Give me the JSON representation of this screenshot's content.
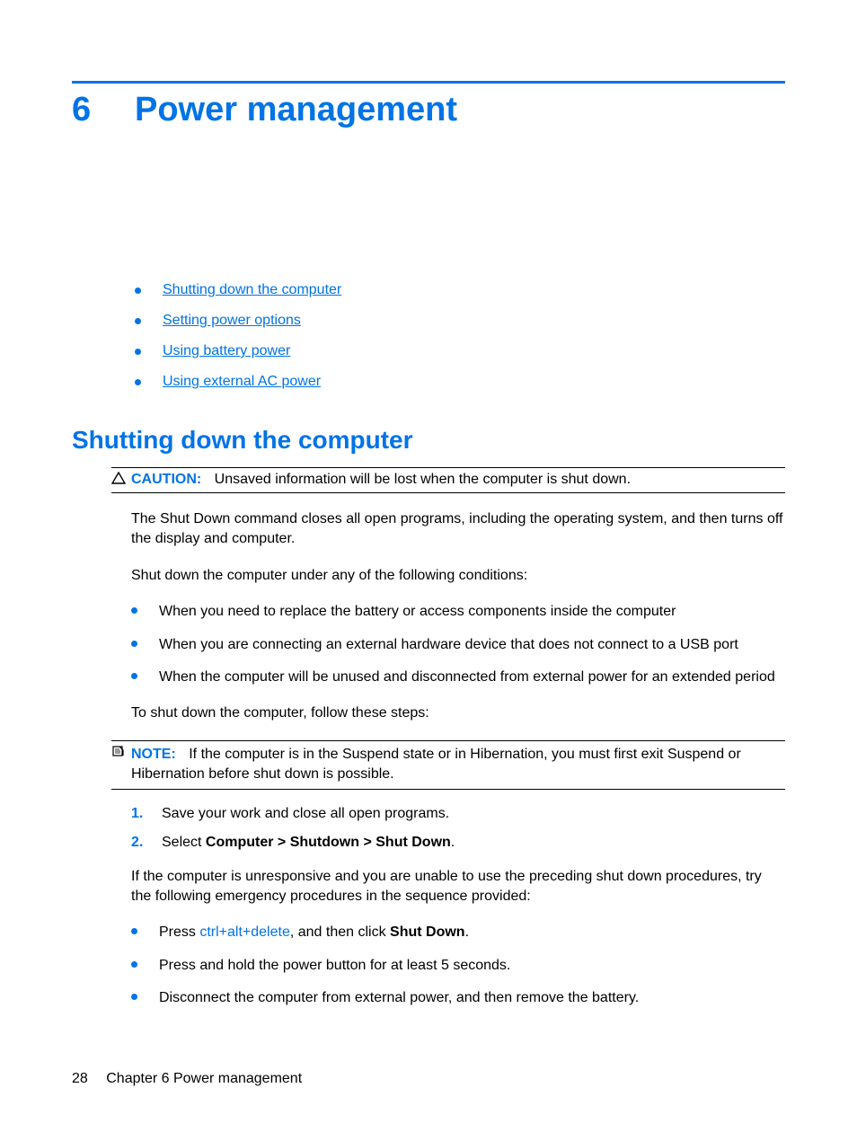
{
  "chapter": {
    "number": "6",
    "title": "Power management"
  },
  "toc": [
    "Shutting down the computer",
    "Setting power options",
    "Using battery power",
    "Using external AC power"
  ],
  "section": {
    "title": "Shutting down the computer",
    "caution": {
      "label": "CAUTION:",
      "text": "Unsaved information will be lost when the computer is shut down."
    },
    "p1": "The Shut Down command closes all open programs, including the operating system, and then turns off the display and computer.",
    "p2": "Shut down the computer under any of the following conditions:",
    "conditions": [
      "When you need to replace the battery or access components inside the computer",
      "When you are connecting an external hardware device that does not connect to a USB port",
      "When the computer will be unused and disconnected from external power for an extended period"
    ],
    "p3": "To shut down the computer, follow these steps:",
    "note": {
      "label": "NOTE:",
      "text": "If the computer is in the Suspend state or in Hibernation, you must first exit Suspend or Hibernation before shut down is possible."
    },
    "steps": {
      "s1_num": "1.",
      "s1_text": "Save your work and close all open programs.",
      "s2_num": "2.",
      "s2_prefix": "Select ",
      "s2_bold": "Computer > Shutdown > Shut Down",
      "s2_suffix": "."
    },
    "p4": "If the computer is unresponsive and you are unable to use the preceding shut down procedures, try the following emergency procedures in the sequence provided:",
    "emergency": {
      "e1_prefix": "Press ",
      "e1_kbd": "ctrl+alt+delete",
      "e1_mid": ", and then click ",
      "e1_bold": "Shut Down",
      "e1_suffix": ".",
      "e2": "Press and hold the power button for at least 5 seconds.",
      "e3": "Disconnect the computer from external power, and then remove the battery."
    }
  },
  "footer": {
    "page": "28",
    "label": "Chapter 6   Power management"
  }
}
